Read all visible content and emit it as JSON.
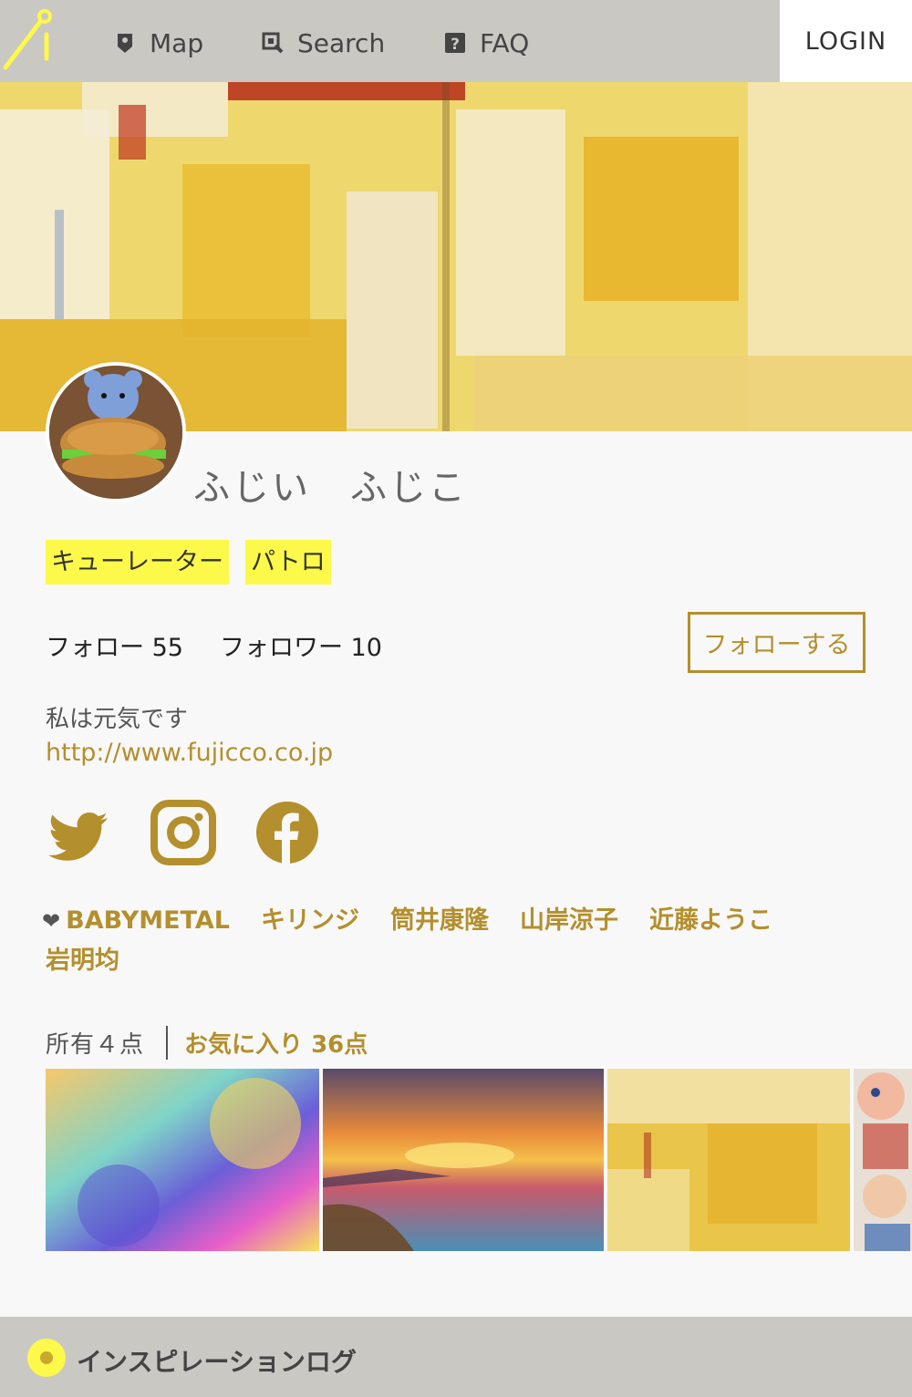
{
  "nav": {
    "items": [
      {
        "label": "Map",
        "icon": "map-pin-icon"
      },
      {
        "label": "Search",
        "icon": "search-icon"
      },
      {
        "label": "FAQ",
        "icon": "question-icon"
      }
    ],
    "login_label": "LOGIN"
  },
  "profile": {
    "name": "ふじい　ふじこ",
    "badges": [
      "キューレーター",
      "パトロ"
    ],
    "follow_label": "フォロー 55",
    "follower_label": "フォロワー 10",
    "follow_button": "フォローする",
    "bio": "私は元気です",
    "url": "http://www.fujicco.co.jp",
    "social": [
      "twitter-icon",
      "instagram-icon",
      "facebook-icon"
    ],
    "likes": [
      "BABYMETAL",
      "キリンジ",
      "筒井康隆",
      "山岸涼子",
      "近藤ようこ",
      "岩明均"
    ]
  },
  "collection": {
    "owned_label": "所有４点",
    "favorites_label": "お気に入り 36点"
  },
  "footer": {
    "title": "インスピレーションログ"
  },
  "colors": {
    "accent": "#b38f2d",
    "badge": "#fcf94a",
    "bar": "#c9c8c3"
  }
}
